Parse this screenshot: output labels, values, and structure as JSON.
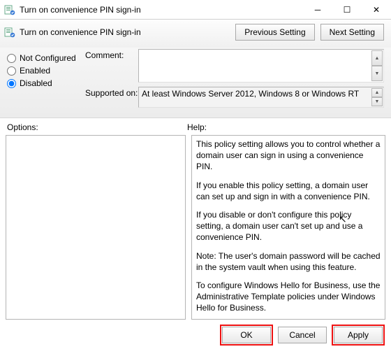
{
  "window": {
    "title": "Turn on convenience PIN sign-in"
  },
  "header": {
    "policy_name": "Turn on convenience PIN sign-in",
    "prev_label": "Previous Setting",
    "next_label": "Next Setting"
  },
  "state": {
    "not_configured_label": "Not Configured",
    "enabled_label": "Enabled",
    "disabled_label": "Disabled",
    "selected": "disabled"
  },
  "fields": {
    "comment_label": "Comment:",
    "comment_value": "",
    "supported_label": "Supported on:",
    "supported_value": "At least Windows Server 2012, Windows 8 or Windows RT"
  },
  "panels": {
    "options_label": "Options:",
    "help_label": "Help:",
    "help_paragraphs": [
      "This policy setting allows you to control whether a domain user can sign in using a convenience PIN.",
      "If you enable this policy setting, a domain user can set up and sign in with a convenience PIN.",
      "If you disable or don't configure this policy setting, a domain user can't set up and use a convenience PIN.",
      "Note: The user's domain password will be cached in the system vault when using this feature.",
      "To configure Windows Hello for Business, use the Administrative Template policies under Windows Hello for Business."
    ]
  },
  "footer": {
    "ok_label": "OK",
    "cancel_label": "Cancel",
    "apply_label": "Apply"
  }
}
